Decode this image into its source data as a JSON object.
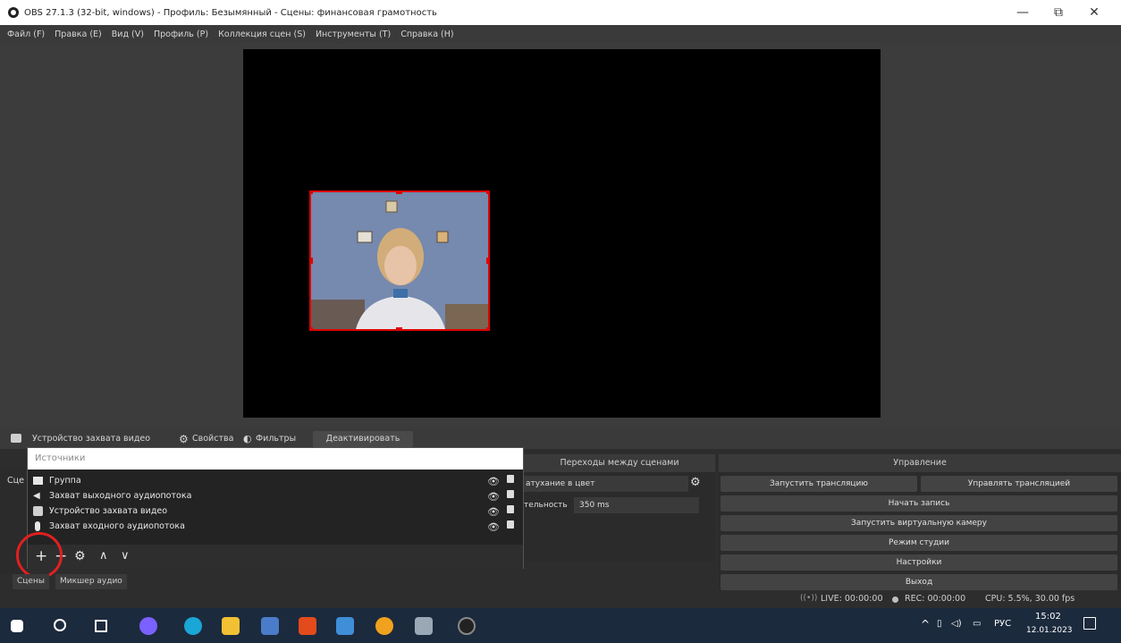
{
  "window": {
    "title": "OBS 27.1.3 (32-bit, windows) - Профиль: Безымянный - Сцены: финансовая грамотность",
    "minimize": "—",
    "maximize": "⧉",
    "close": "✕"
  },
  "menu": [
    "Файл (F)",
    "Правка (E)",
    "Вид (V)",
    "Профиль (P)",
    "Коллекция сцен (S)",
    "Инструменты (T)",
    "Справка (H)"
  ],
  "source_toolbar": {
    "selected_source": "Устройство захвата видео",
    "properties": "Свойства",
    "filters": "Фильтры",
    "deactivate": "Деактивировать"
  },
  "sources": {
    "title": "Источники",
    "items": [
      {
        "icon": "folder-icon",
        "label": "Группа"
      },
      {
        "icon": "speaker-icon",
        "label": "Захват выходного аудиопотока"
      },
      {
        "icon": "camera-icon",
        "label": "Устройство захвата видео"
      },
      {
        "icon": "microphone-icon",
        "label": "Захват входного аудиопотока"
      }
    ]
  },
  "scenes_partial_label": "Сце",
  "transitions": {
    "title": "Переходы между сценами",
    "transition_value": "атухание в цвет",
    "duration_label": "тельность",
    "duration_value": "350 ms"
  },
  "controls": {
    "title": "Управление",
    "start_stream": "Запустить трансляцию",
    "manage_stream": "Управлять трансляцией",
    "start_recording": "Начать запись",
    "virtual_camera": "Запустить виртуальную камеру",
    "studio_mode": "Режим студии",
    "settings": "Настройки",
    "exit": "Выход"
  },
  "tabs": {
    "scenes": "Сцены",
    "mixer": "Микшер аудио"
  },
  "status": {
    "live": "LIVE: 00:00:00",
    "rec": "REC: 00:00:00",
    "cpu": "CPU: 5.5%, 30.00 fps"
  },
  "taskbar": {
    "lang": "РУС",
    "time": "15:02",
    "date": "12.01.2023"
  },
  "colors": {
    "selection_red": "#e00000",
    "taskbar": "#1c2a3d"
  }
}
